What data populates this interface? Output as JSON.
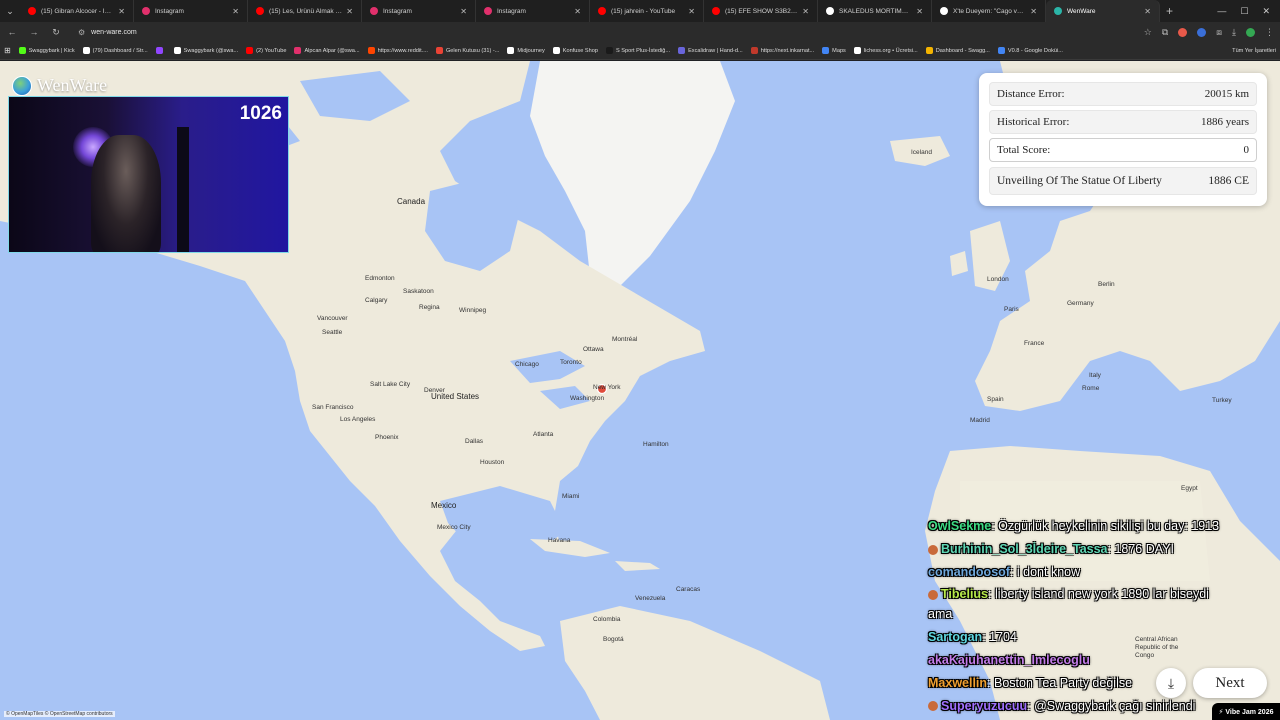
{
  "browser": {
    "tabs": [
      {
        "title": "(15) Gibran Alcocer - Idea 10",
        "favicon_color": "#ff0000",
        "active": false
      },
      {
        "title": "Instagram",
        "favicon_color": "#e1306c",
        "active": false
      },
      {
        "title": "(15) Les, Ürünü Almak İçin Mü",
        "favicon_color": "#ff0000",
        "active": false
      },
      {
        "title": "Instagram",
        "favicon_color": "#e1306c",
        "active": false
      },
      {
        "title": "Instagram",
        "favicon_color": "#e1306c",
        "active": false
      },
      {
        "title": "(15) jahrein - YouTube",
        "favicon_color": "#ff0000",
        "active": false
      },
      {
        "title": "(15) EFE SHOW S3B26 | MÜSİ",
        "favicon_color": "#ff0000",
        "active": false
      },
      {
        "title": "SKALEDUS MORTIMAS Toplu",
        "favicon_color": "#ffffff",
        "active": false
      },
      {
        "title": "X'te Dueyern: \"Cago vergi mü",
        "favicon_color": "#ffffff",
        "active": false
      },
      {
        "title": "WenWare",
        "favicon_color": "#2bb5a8",
        "active": true
      }
    ],
    "url": "wen-ware.com",
    "bookmarks": [
      {
        "label": "Swaggybark | Kick",
        "color": "#53fc18"
      },
      {
        "label": "(79) Dashboard / Str...",
        "color": "#ffffff"
      },
      {
        "label": "",
        "color": "#9146ff"
      },
      {
        "label": "Swaggybark (@swa...",
        "color": "#ffffff"
      },
      {
        "label": "(2) YouTube",
        "color": "#ff0000"
      },
      {
        "label": "Alpcan Alpar (@swa...",
        "color": "#e1306c"
      },
      {
        "label": "https://www.reddit....",
        "color": "#ff4500"
      },
      {
        "label": "Gelen Kutusu (31) -...",
        "color": "#ea4335"
      },
      {
        "label": "Midjourney",
        "color": "#ffffff"
      },
      {
        "label": "Konfuse Shop",
        "color": "#ffffff"
      },
      {
        "label": "S Sport Plus-İstediğ...",
        "color": "#1a1a1a"
      },
      {
        "label": "Excalidraw | Hand-d...",
        "color": "#6965db"
      },
      {
        "label": "https://next.inkarnat...",
        "color": "#c0392b"
      },
      {
        "label": "Maps",
        "color": "#4285f4"
      },
      {
        "label": "lichess.org • Ücretsi...",
        "color": "#ffffff"
      },
      {
        "label": "Dashboard - Swagg...",
        "color": "#f4b400"
      },
      {
        "label": "V0.8 - Google Doküi...",
        "color": "#4285f4"
      }
    ],
    "all_bookmarks": "Tüm Yer İşaretleri"
  },
  "app": {
    "name": "WenWare",
    "score_counter": "1026"
  },
  "scorecard": {
    "distance_label": "Distance Error:",
    "distance_value": "20015 km",
    "historical_label": "Historical Error:",
    "historical_value": "1886 years",
    "total_label": "Total Score:",
    "total_value": "0",
    "event_name": "Unveiling Of The Statue Of Liberty",
    "event_year": "1886 CE"
  },
  "map_labels": {
    "canada": "Canada",
    "united_states": "United States",
    "mexico": "Mexico",
    "iceland": "Iceland",
    "germany": "Germany",
    "france": "France",
    "spain": "Spain",
    "italy": "Italy",
    "turkey": "Turkey",
    "egypt": "Egypt",
    "colombia": "Colombia",
    "hamilton": "Hamilton",
    "havana": "Havana",
    "mexico_city": "Mexico City",
    "washington": "Washington",
    "new_york": "New York",
    "chicago": "Chicago",
    "toronto": "Toronto",
    "ottawa": "Ottawa",
    "montreal": "Montréal",
    "edmonton": "Edmonton",
    "calgary": "Calgary",
    "vancouver": "Vancouver",
    "seattle": "Seattle",
    "winnipeg": "Winnipeg",
    "regina": "Regina",
    "saskatoon": "Saskatoon",
    "denver": "Denver",
    "dallas": "Dallas",
    "houston": "Houston",
    "phoenix": "Phoenix",
    "los_angeles": "Los Angeles",
    "san_francisco": "San Francisco",
    "salt_lake": "Salt Lake City",
    "atlanta": "Atlanta",
    "miami": "Miami",
    "london": "London",
    "paris": "Paris",
    "madrid": "Madrid",
    "rome": "Rome",
    "berlin": "Berlin",
    "bogota": "Bogotá",
    "caracas": "Caracas",
    "central_african": "Central African Republic of the Congo",
    "venezuela": "Venezuela"
  },
  "chat": [
    {
      "user": "OwlSekme",
      "color": "#3ddc84",
      "text": ": Özgürlük heykelinin sikilişi bu day: 1913",
      "badge": false
    },
    {
      "user": "Burhinin_Sol_3İdeire_Tassa",
      "color": "#5fd7b5",
      "text": ": 1876 DAYI",
      "badge": true
    },
    {
      "user": "comandoosof",
      "color": "#6fa8dc",
      "text": ": i dont know",
      "badge": false
    },
    {
      "user": "Tibelius",
      "color": "#b7e94a",
      "text": ": liberty island new york 1890 lar biseydi",
      "badge": true
    },
    {
      "user": "",
      "color": "#ffffff",
      "text": "ama",
      "badge": false
    },
    {
      "user": "Sartogan",
      "color": "#5fd7e0",
      "text": ": 1704",
      "badge": false
    },
    {
      "user": "akaKajuhanettin_Imlecoglu",
      "color": "#c27ce8",
      "text": "",
      "badge": false
    },
    {
      "user": "Maxwellin",
      "color": "#f0a030",
      "text": ": Boston Tea Party değilse",
      "badge": false
    },
    {
      "user": "Superyuzucuu",
      "color": "#a070ff",
      "text": ": @Swaggybark çağı sinirlendi",
      "badge": true
    }
  ],
  "controls": {
    "download_icon": "download-icon",
    "next_label": "Next"
  },
  "attribution": "© OpenMapTiles © OpenStreetMap contributors",
  "vibe_jam": "⚡ Vibe Jam 2026",
  "colors": {
    "ocean": "#a8c4f5",
    "land": "#eeeadc",
    "guess_marker": "#e04b3a"
  }
}
